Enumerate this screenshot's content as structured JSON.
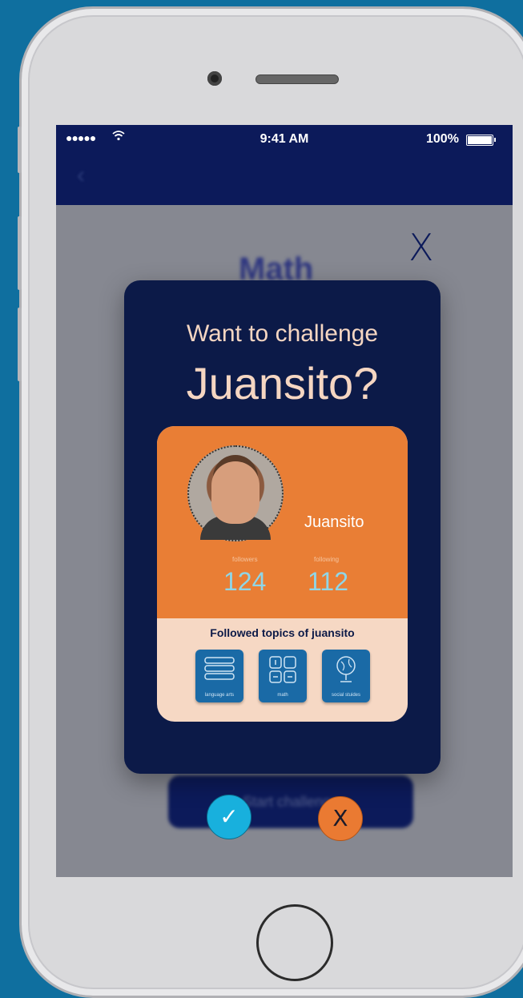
{
  "status_bar": {
    "signal": "●●●●● ",
    "time": "9:41 AM",
    "battery": "100%"
  },
  "background": {
    "title": "Math",
    "button_label": "Start challenge"
  },
  "close_glyph": "X",
  "modal": {
    "question": "Want to challenge",
    "name": "Juansito?",
    "card": {
      "user_name": "Juansito",
      "followers_label": "followers",
      "followers_value": "124",
      "following_label": "following",
      "following_value": "112",
      "topics_title": "Followed topics of juansito",
      "topics": [
        {
          "label": "language arts",
          "icon": "books-icon"
        },
        {
          "label": "math",
          "icon": "calculator-icon"
        },
        {
          "label": "social stuides",
          "icon": "globe-icon"
        }
      ]
    }
  },
  "actions": {
    "accept_glyph": "✓",
    "decline_glyph": "X"
  },
  "colors": {
    "navy": "#0c1a48",
    "orange": "#e97e35",
    "peach": "#f6d8c4",
    "cyan": "#18b0dd"
  }
}
